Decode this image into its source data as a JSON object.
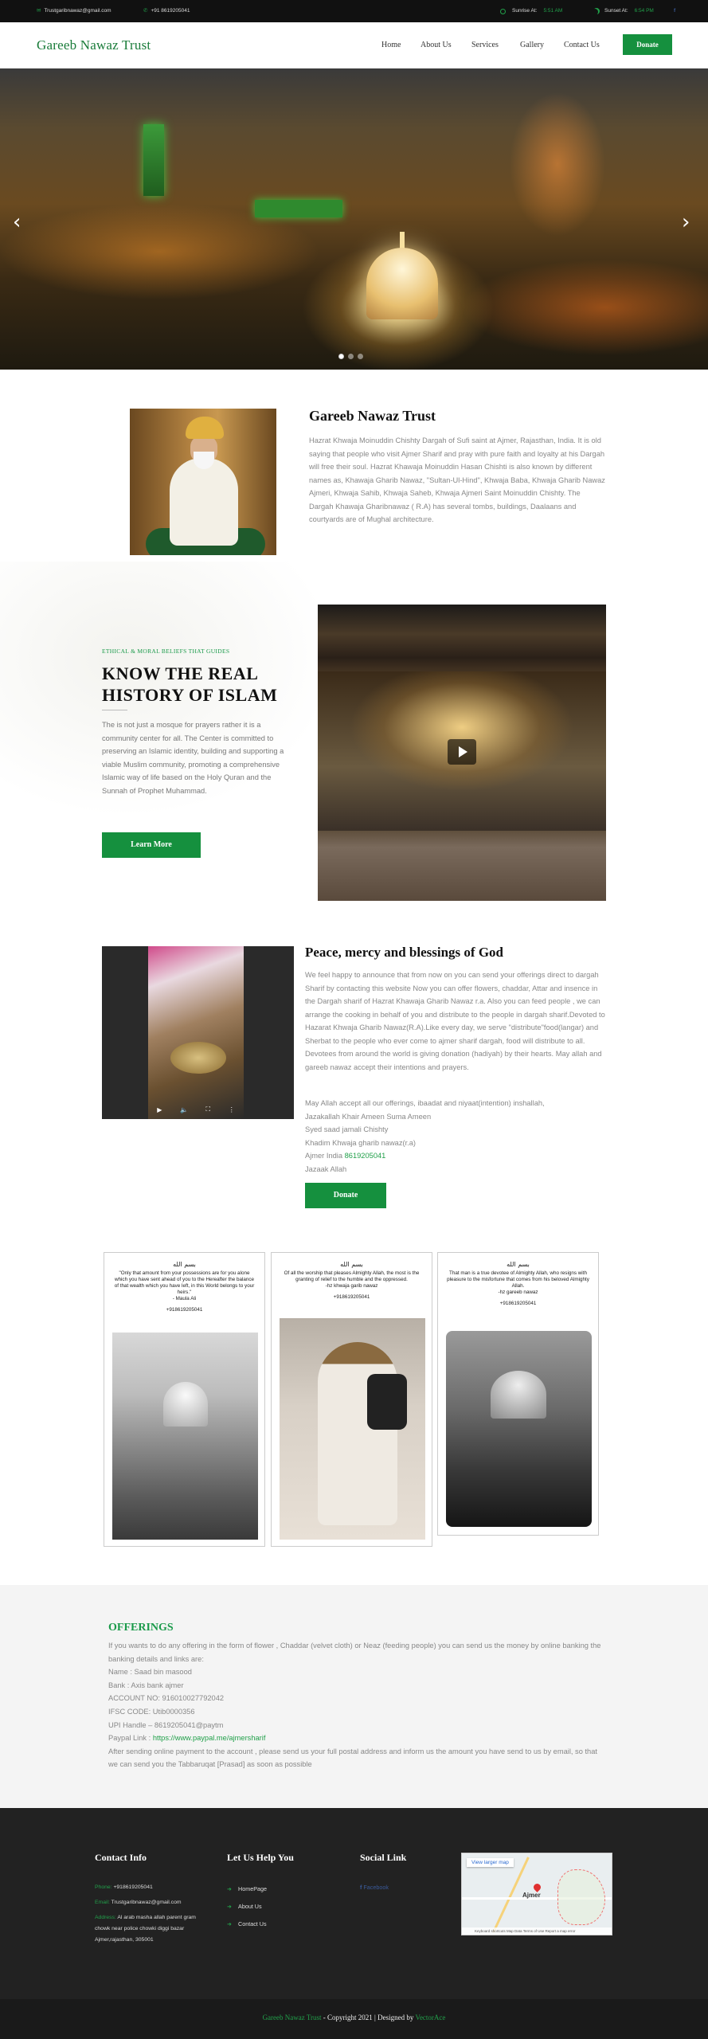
{
  "topbar": {
    "email": "Trustgaribnawaz@gmail.com",
    "phone": "+91 8619205041",
    "sunrise_label": "Sunrise At:",
    "sunrise_time": "5:51 AM",
    "sunset_label": "Sunset At:",
    "sunset_time": "6:54 PM",
    "social_icon": "facebook-icon"
  },
  "header": {
    "brand": "Gareeb Nawaz Trust",
    "nav": [
      "Home",
      "About Us",
      "Services",
      "Gallery",
      "Contact Us"
    ],
    "donate": "Donate"
  },
  "hero": {
    "prev": "‹",
    "next": "›",
    "slides": 3,
    "active_slide": 1
  },
  "about": {
    "title": "Gareeb Nawaz Trust",
    "text": "Hazrat Khwaja Moinuddin Chishty Dargah of Sufi saint at Ajmer, Rajasthan, India. It is old saying that people who visit Ajmer Sharif and pray with pure faith and loyalty at his Dargah will free their soul. Hazrat Khawaja Moinuddin Hasan Chishti is also known by different names as, Khawaja Gharib Nawaz, \"Sultan-Ul-Hind\", Khwaja Baba, Khwaja Gharib Nawaz Ajmeri, Khwaja Sahib, Khwaja Saheb, Khwaja Ajmeri Saint Moinuddin Chishty. The Dargah Khawaja Gharibnawaz ( R.A) has several tombs, buildings, Daalaans and courtyards are of Mughal architecture."
  },
  "history": {
    "kicker": "ETHICAL & MORAL BELIEFS THAT GUIDES",
    "title": "KNOW THE REAL HISTORY OF ISLAM",
    "text": "The is not just a mosque for prayers rather it is a community center for all. The Center is committed to preserving an Islamic identity, building and supporting a viable Muslim community, promoting a comprehensive Islamic way of life based on the Holy Quran and the Sunnah of Prophet Muhammad.",
    "button": "Learn More"
  },
  "peace": {
    "title": "Peace, mercy and blessings of God",
    "text": "We feel happy to announce that from now on you can send your offerings direct to dargah Sharif by contacting this website Now you can offer flowers, chaddar, Attar and insence in the Dargah sharif of Hazrat Khawaja Gharib Nawaz r.a. Also you can feed people , we can arrange the cooking in behalf of you and distribute to the people in dargah sharif.Devoted to Hazarat Khwaja Gharib Nawaz(R.A).Like every day, we serve \"distribute\"food(langar) and Sherbat to the people who ever come to ajmer sharif dargah, food will distribute to all. Devotees from around the world is giving donation (hadiyah) by their hearts. May allah and gareeb nawaz accept their intentions and prayers.",
    "line1": "May Allah accept all our offerings, ibaadat and niyaat(intention) inshallah,",
    "line2": "Jazakallah Khair Ameen Suma Ameen",
    "line3": "Syed saad jamali Chishty",
    "line4": "Khadim Khwaja gharib nawaz(r.a)",
    "line5_prefix": "Ajmer India",
    "line5_phone": "8619205041",
    "line6": "Jazaak Allah",
    "button": "Donate"
  },
  "posters": [
    {
      "bism": "بسم الله",
      "quote": "\"Only that amount from your possessions are for you alone which you have sent ahead of you to the Hereafter the balance of that wealth which you have left, in this World belongs to your heirs.\"\n- Maula Ali",
      "phone": "+918619205041"
    },
    {
      "bism": "بسم الله",
      "quote": "Of all the worship that pleases Almighty Allah, the most is the granting of relief to the humble and the oppressed.\n-hz khwaja garib nawaz",
      "phone": "+918619205041"
    },
    {
      "bism": "بسم الله",
      "quote": "That man is a true devotee of Almighty Allah, who resigns with pleasure to the misfortune that comes from his beloved Almighty Allah.\n-hz gareeb nawaz",
      "phone": "+918619205041"
    }
  ],
  "offerings": {
    "title": "OFFERINGS",
    "intro": "If you wants to do any offering in the form of flower , Chaddar (velvet cloth) or Neaz (feeding people) you can send us the money by online banking the banking details and links are:",
    "name": "Name : Saad bin masood",
    "bank": "Bank : Axis bank ajmer",
    "account": "ACCOUNT NO: 916010027792042",
    "ifsc": "IFSC CODE: Utib0000356",
    "upi": "UPI Handle – 8619205041@paytm",
    "paypal_label": "Paypal Link :",
    "paypal_link": "https://www.paypal.me/ajmersharif",
    "after": "After sending online payment to the account , please send us your full postal address and inform us the amount you have send to us by email, so that we can send you the Tabbaruqat [Prasad] as soon as possible"
  },
  "footer": {
    "contact_title": "Contact Info",
    "phone_label": "Phone:",
    "phone": "+918619205041",
    "email_label": "Email:",
    "email": "Trustgaribnawaz@gmail.com",
    "address_label": "Address:",
    "address": "Al arab masha allah parent gram chowk near police chowki diggi bazar Ajmer,rajasthan, 305001",
    "help_title": "Let Us Help You",
    "links": [
      "HomePage",
      "About Us",
      "Contact Us"
    ],
    "social_title": "Social Link",
    "facebook": "Facebook",
    "map_view": "View larger map",
    "map_city": "Ajmer",
    "map_credits": "Keyboard shortcuts  Map Data  Terms of Use  Report a map error"
  },
  "copyright": {
    "brand": "Gareeb Nawaz Trust",
    "text": " - Copyright 2021 | Designed by ",
    "designer": "VectorAce"
  },
  "colors": {
    "accent": "#15903e",
    "dark": "#222222",
    "topbar": "#111111"
  }
}
